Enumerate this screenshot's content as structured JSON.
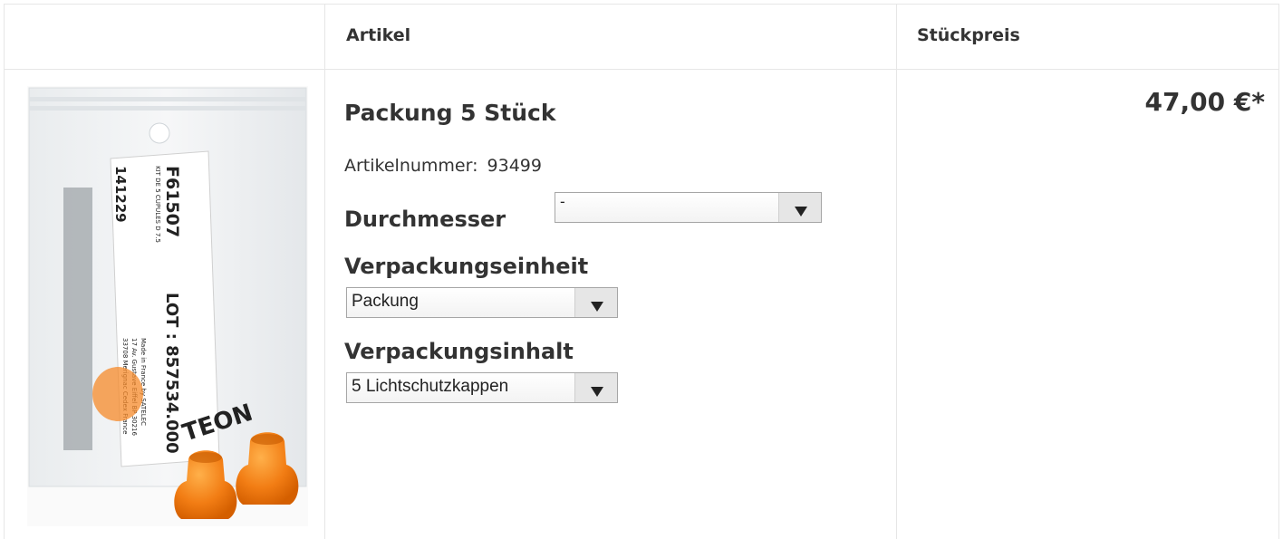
{
  "table": {
    "headers": {
      "image": "",
      "article": "Artikel",
      "unit_price": "Stückpreis"
    }
  },
  "product": {
    "title": "Packung 5 Stück",
    "article_number_label": "Artikelnummer:",
    "article_number": "93499",
    "price": "47,00 €*",
    "image_text": {
      "code": "F61507",
      "description": "KIT DE 5 CUPULES D 7.5",
      "batch": "141229",
      "lot": "LOT : 857534.000",
      "made_in": "Made in France by SATELEC",
      "address1": "17 Av. Gustave Eiffel BP 30216",
      "address2": "33708 Merignac Cedex France",
      "brand": "TEON",
      "brand_top": "SATELEC"
    }
  },
  "options": {
    "durchmesser": {
      "label": "Durchmesser",
      "value": "-"
    },
    "verpackungseinheit": {
      "label": "Verpackungseinheit",
      "value": "Packung"
    },
    "verpackungsinhalt": {
      "label": "Verpackungsinhalt",
      "value": "5 Lichtschutzkappen"
    }
  },
  "colors": {
    "grid": "#e6e6e6",
    "text": "#333333",
    "cap": "#f07a12"
  }
}
